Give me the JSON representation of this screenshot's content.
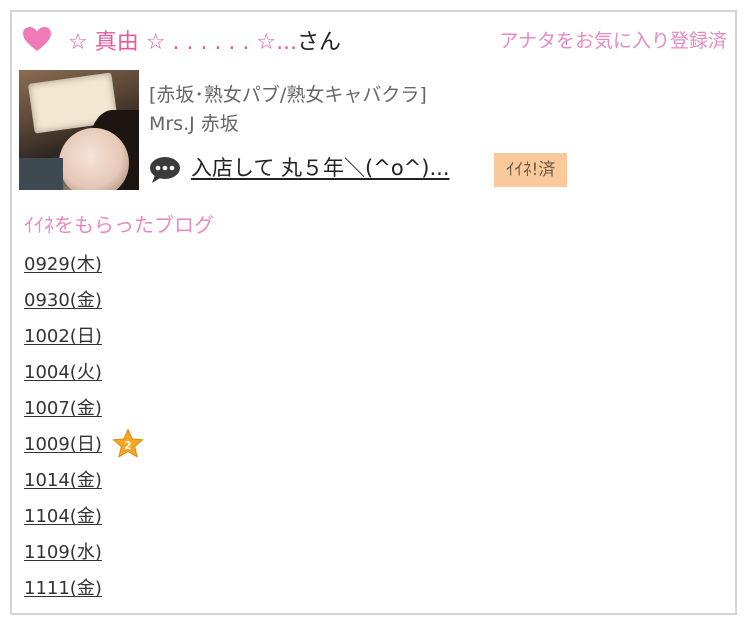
{
  "header": {
    "name": "☆ 真由 ☆ . . . . . . ☆...",
    "name_suffix": "さん",
    "favorite_status": "アナタをお気に入り登録済"
  },
  "shop": {
    "category": "[赤坂･熟女パブ/熟女キャバクラ]",
    "name": "Mrs.J 赤坂"
  },
  "post": {
    "title": "入店して 丸５年＼(^o^)...",
    "iine_badge": "ｲｲﾈ!済"
  },
  "blogs": {
    "section_title": "ｲｲﾈをもらったブログ",
    "items": [
      {
        "label": "0929(木)"
      },
      {
        "label": "0930(金)"
      },
      {
        "label": "1002(日)"
      },
      {
        "label": "1004(火)"
      },
      {
        "label": "1007(金)"
      },
      {
        "label": "1009(日)",
        "badge": "star",
        "badge_text": "2"
      },
      {
        "label": "1014(金)"
      },
      {
        "label": "1104(金)"
      },
      {
        "label": "1109(水)"
      },
      {
        "label": "1111(金)"
      }
    ]
  },
  "colors": {
    "accent_pink": "#e65a9d",
    "light_pink": "#e889c4",
    "badge_orange": "#f9c99b",
    "border": "#d4d4d4"
  },
  "icons": {
    "heart": "heart-icon",
    "bubble": "speech-bubble-icon",
    "star": "star-badge-icon"
  }
}
